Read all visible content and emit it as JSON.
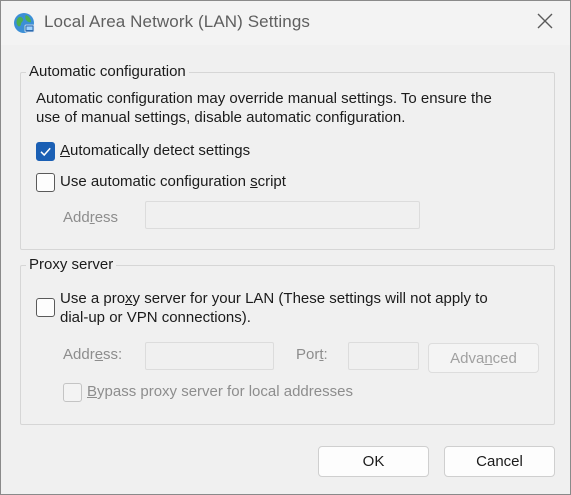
{
  "window": {
    "title": "Local Area Network (LAN) Settings",
    "icon": "globe-network-icon",
    "close_icon": "close-icon"
  },
  "auto_config": {
    "legend": "Automatic configuration",
    "description_line1": "Automatic configuration may override manual settings.  To ensure the",
    "description_line2": "use of manual settings, disable automatic configuration.",
    "detect_settings": {
      "label_pre": "",
      "label_accel": "A",
      "label_post": "utomatically detect settings",
      "checked": true
    },
    "use_script": {
      "label_pre": "Use automatic configuration ",
      "label_accel": "s",
      "label_post": "cript",
      "checked": false
    },
    "address_label_pre": "Add",
    "address_label_accel": "r",
    "address_label_post": "ess",
    "address_value": ""
  },
  "proxy": {
    "legend": "Proxy server",
    "use_proxy_line1_pre": "Use a pro",
    "use_proxy_line1_accel": "x",
    "use_proxy_line1_post": "y server for your LAN (These settings will not apply to",
    "use_proxy_line2": "dial-up or VPN connections).",
    "use_proxy_checked": false,
    "address_label_pre": "Addr",
    "address_label_accel": "e",
    "address_label_post": "ss:",
    "port_label_pre": "Por",
    "port_label_accel": "t",
    "port_label_post": ":",
    "advanced_pre": "Adva",
    "advanced_accel": "n",
    "advanced_post": "ced",
    "bypass_pre": "",
    "bypass_accel": "B",
    "bypass_post": "ypass proxy server for local addresses",
    "bypass_checked": false
  },
  "buttons": {
    "ok": "OK",
    "cancel": "Cancel"
  },
  "colors": {
    "accent": "#1a5fb4",
    "window_bg": "#f0f0f0"
  }
}
